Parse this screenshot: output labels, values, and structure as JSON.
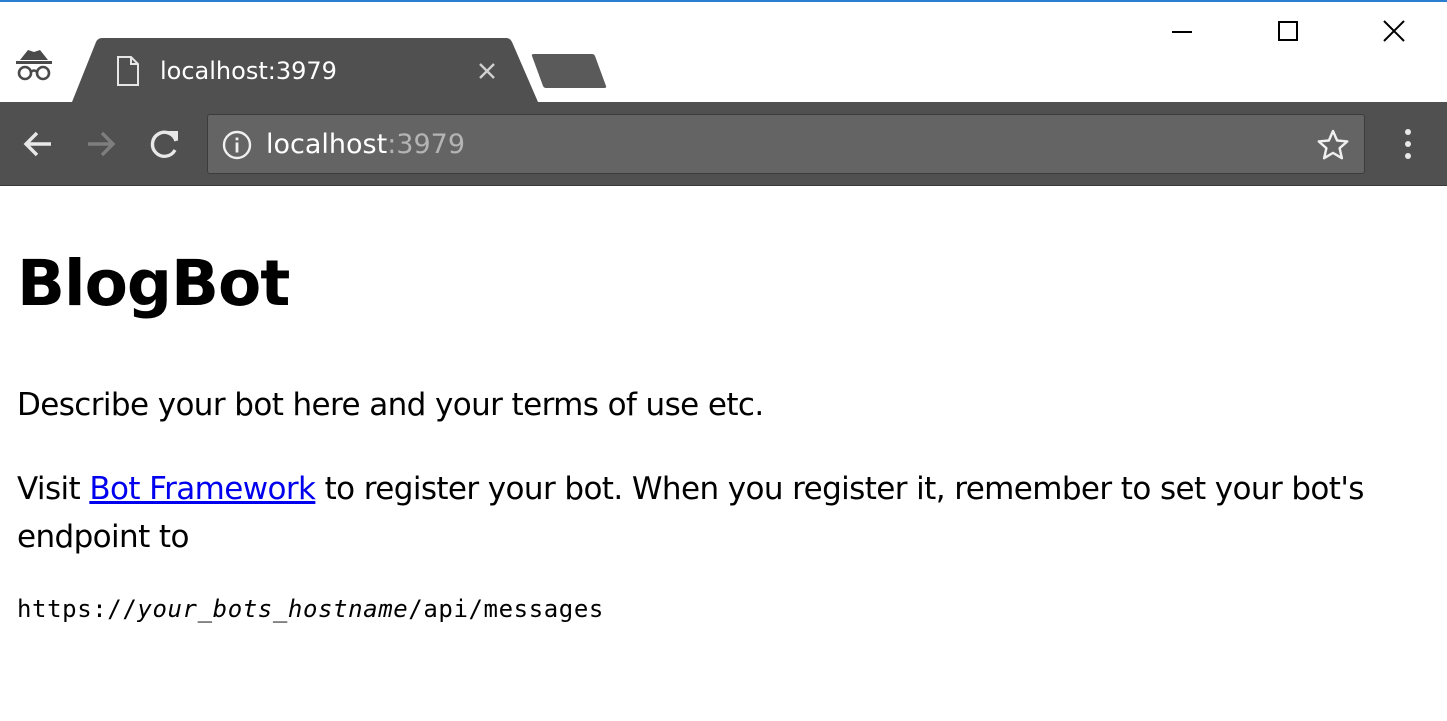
{
  "browser": {
    "tab": {
      "title": "localhost:3979",
      "icon": "document-icon"
    },
    "omnibox": {
      "host": "localhost",
      "port": ":3979"
    },
    "colors": {
      "tab_active": "#505050",
      "toolbar": "#505050",
      "omnibox": "#646464",
      "accent_line": "#2b7fd0"
    }
  },
  "page": {
    "title": "BlogBot",
    "description": "Describe your bot here and your terms of use etc.",
    "visit_prefix": "Visit ",
    "link_text": "Bot Framework",
    "visit_suffix": " to register your bot. When you register it, remember to set your bot's endpoint to",
    "endpoint": {
      "scheme": "https://",
      "host_placeholder": "your_bots_hostname",
      "path": "/api/messages"
    },
    "link_color": "#0000ee"
  }
}
